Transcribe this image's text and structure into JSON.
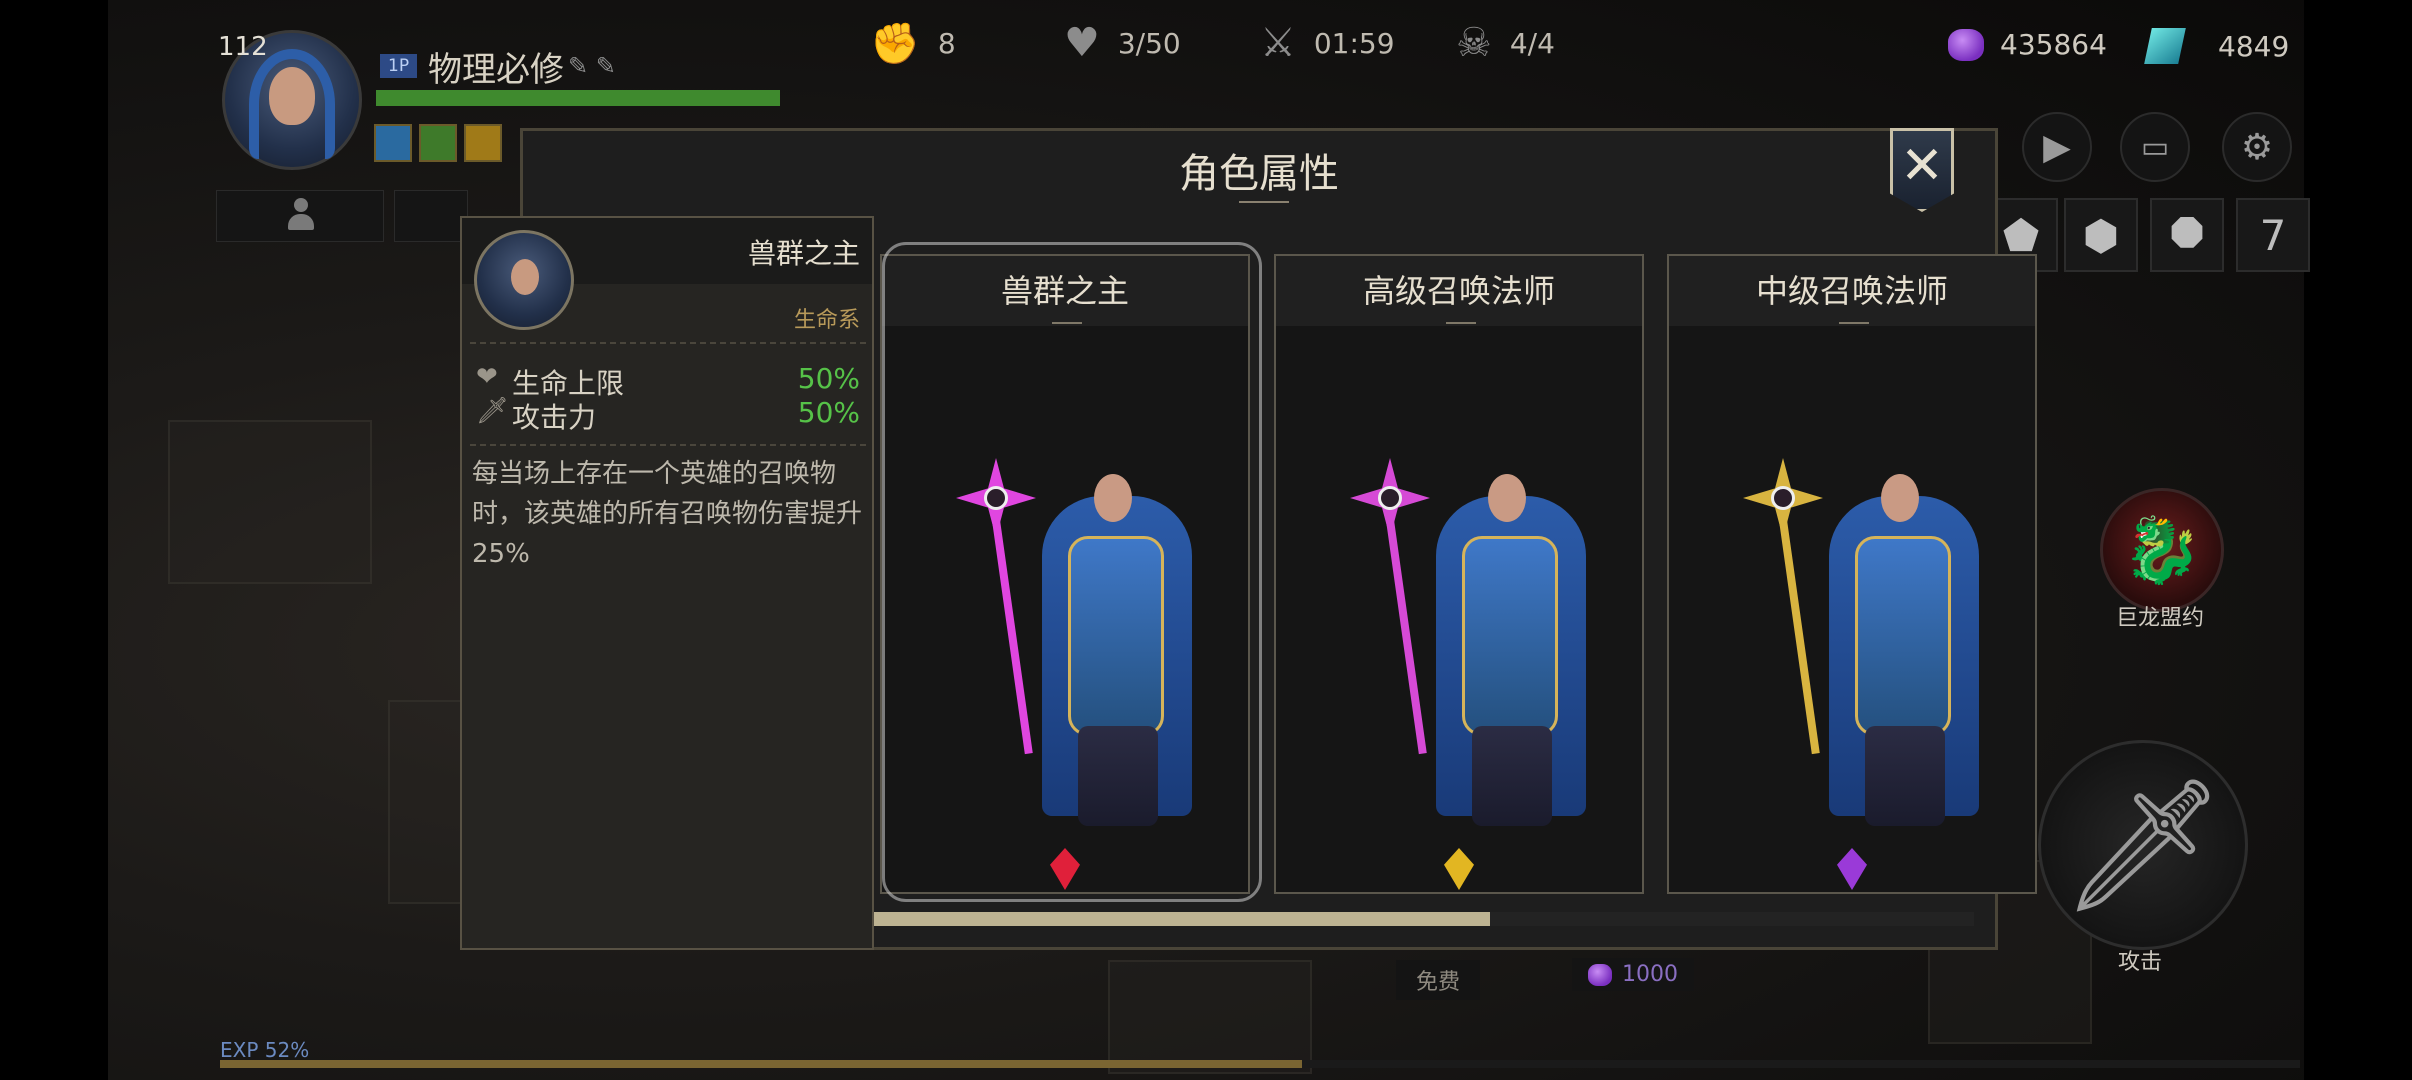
{
  "hud": {
    "level": "112",
    "player_tag": "1P",
    "player_name": "物理必修",
    "hp_fraction": 1.0,
    "stats": [
      {
        "icon": "fist-icon",
        "glyph": "✊",
        "value": "8"
      },
      {
        "icon": "heart-icon",
        "glyph": "♥",
        "value": "3/50"
      },
      {
        "icon": "crossed-swords-icon",
        "glyph": "⚔",
        "value": "01:59"
      },
      {
        "icon": "skull-icon",
        "glyph": "☠",
        "value": "4/4"
      }
    ],
    "currency": [
      {
        "icon": "purple-gem-icon",
        "value": "435864"
      },
      {
        "icon": "teal-crystal-icon",
        "value": "4849"
      }
    ],
    "skill_slot_last": "7",
    "dragon_label": "巨龙盟约",
    "attack_label": "攻击",
    "exp_label": "EXP 52%",
    "exp_fraction": 0.52,
    "below_free": "免费",
    "below_cost": "1000"
  },
  "dialog": {
    "title": "角色属性",
    "close_glyph": "✕"
  },
  "info": {
    "name": "兽群之主",
    "class": "生命系",
    "stats": [
      {
        "name": "生命上限",
        "value": "50%"
      },
      {
        "name": "攻击力",
        "value": "50%"
      }
    ],
    "description": "每当场上存在一个英雄的召唤物时，该英雄的所有召唤物伤害提升25%"
  },
  "cards": [
    {
      "title": "兽群之主",
      "staff_color": "#e046e0",
      "gem_color": "#e0203a",
      "selected": true
    },
    {
      "title": "高级召唤法师",
      "staff_color": "#d64ad6",
      "gem_color": "#e2b622",
      "selected": false
    },
    {
      "title": "中级召唤法师",
      "staff_color": "#d8b440",
      "gem_color": "#9a3ad8",
      "selected": false
    }
  ],
  "scroll_fraction": 0.56
}
